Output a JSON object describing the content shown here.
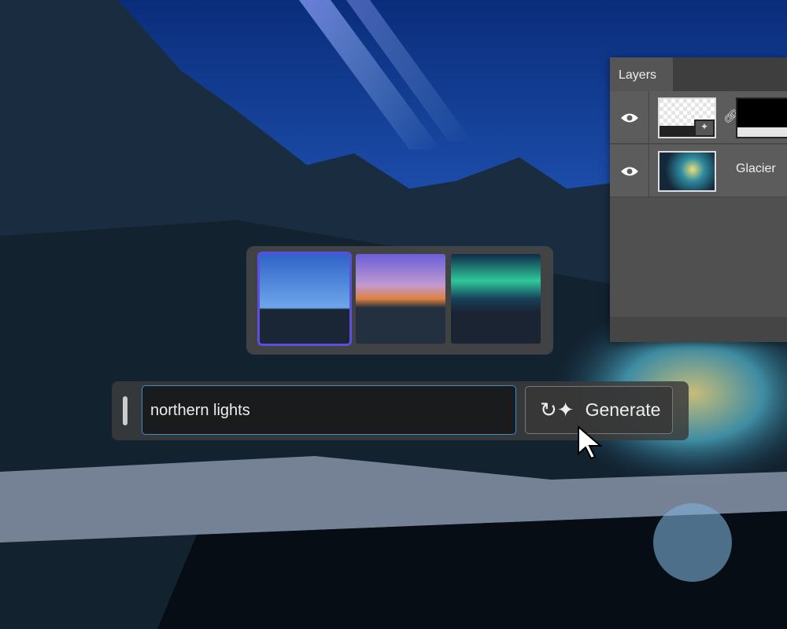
{
  "canvas": {
    "image": "glacier ice cave with mountains and aurora sky"
  },
  "layers_panel": {
    "tab_label": "Layers",
    "layers": [
      {
        "name": "",
        "visible": true,
        "type": "generative-fill-layer",
        "has_mask": true
      },
      {
        "name": "Glacier",
        "visible": true,
        "type": "image-layer"
      }
    ]
  },
  "variations": {
    "selected_index": 0,
    "items": [
      "aurora streaks variation",
      "sunset-lit peak variation",
      "green aurora variation"
    ]
  },
  "prompt_bar": {
    "prompt_value": "northern lights",
    "generate_label": "Generate"
  },
  "colors": {
    "accent_focus": "#3a8ed0",
    "selection": "#5b4fe0",
    "panel": "#505050"
  }
}
